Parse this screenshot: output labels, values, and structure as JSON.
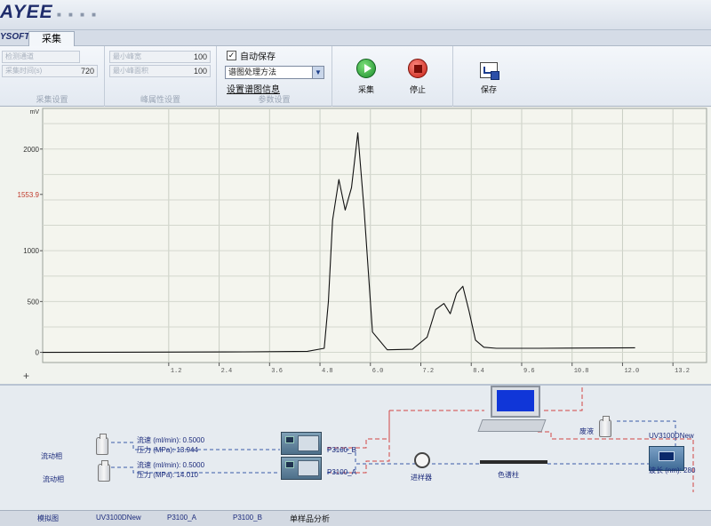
{
  "app": {
    "logo": "AYEE",
    "menu_label": "YSOFT",
    "tab_active": "采集"
  },
  "ribbon": {
    "acquire_settings": {
      "caption": "采集设置",
      "channel_field": "检测通道",
      "time_field": "采集时间(s)",
      "time_value": "720"
    },
    "peak_settings": {
      "caption": "峰属性设置",
      "min_width_label": "最小峰宽",
      "min_width_value": "100",
      "min_area_label": "最小峰面积",
      "min_area_value": "100"
    },
    "param_settings": {
      "caption": "参数设置",
      "autosave_label": "自动保存",
      "autosave_checked": "✓",
      "method_value": "谱图处理方法",
      "dropdown_icon": "chevron-down-icon",
      "info_link": "设置谱图信息"
    },
    "buttons": {
      "start_label": "采集",
      "stop_label": "停止",
      "save_label": "保存"
    }
  },
  "chart_data": {
    "type": "line",
    "title": "",
    "xlabel": "",
    "ylabel": "mV",
    "ylim": [
      -100,
      2400
    ],
    "xlim": [
      -1.8,
      14.0
    ],
    "y_ticks": [
      "0",
      "500",
      "1000",
      "1553.9",
      "2000"
    ],
    "x_ticks": [
      "1.2",
      "2.4",
      "3.6",
      "4.8",
      "6.0",
      "7.2",
      "8.4",
      "9.6",
      "10.8",
      "12.0",
      "13.2"
    ],
    "cursor_value": "1553.9",
    "grid": true,
    "series": [
      {
        "color": "#111111",
        "x": [
          -1.8,
          3.0,
          4.5,
          4.9,
          5.0,
          5.1,
          5.25,
          5.4,
          5.55,
          5.7,
          5.85,
          6.05,
          6.4,
          7.0,
          7.35,
          7.55,
          7.75,
          7.9,
          8.05,
          8.2,
          8.35,
          8.5,
          8.7,
          9.0,
          10.0,
          12.3
        ],
        "y": [
          0,
          5,
          10,
          40,
          500,
          1300,
          1700,
          1400,
          1620,
          2160,
          1400,
          200,
          25,
          30,
          150,
          420,
          480,
          380,
          580,
          650,
          400,
          120,
          50,
          40,
          40,
          45
        ]
      }
    ]
  },
  "schematic": {
    "mobile_phase_a": "流动相",
    "mobile_phase_b": "流动相",
    "flow_b_label": "流速 (ml/min): 0.5000",
    "pressure_b_label": "压力 (MPa): 13.944",
    "flow_a_label": "流速 (ml/min): 0.5000",
    "pressure_a_label": "压力 (MPa): 14.010",
    "pump_b_name": "P3100_B",
    "pump_a_name": "P3100_A",
    "injector_label": "进样器",
    "column_label": "色谱柱",
    "waste_label": "废液",
    "detector_model": "UV3100DNew",
    "wavelength_label": "波长 (nm): 280"
  },
  "bottom_tabs": [
    "模拟图",
    "UV3100DNew",
    "P3100_A",
    "P3100_B",
    "单样品分析"
  ]
}
